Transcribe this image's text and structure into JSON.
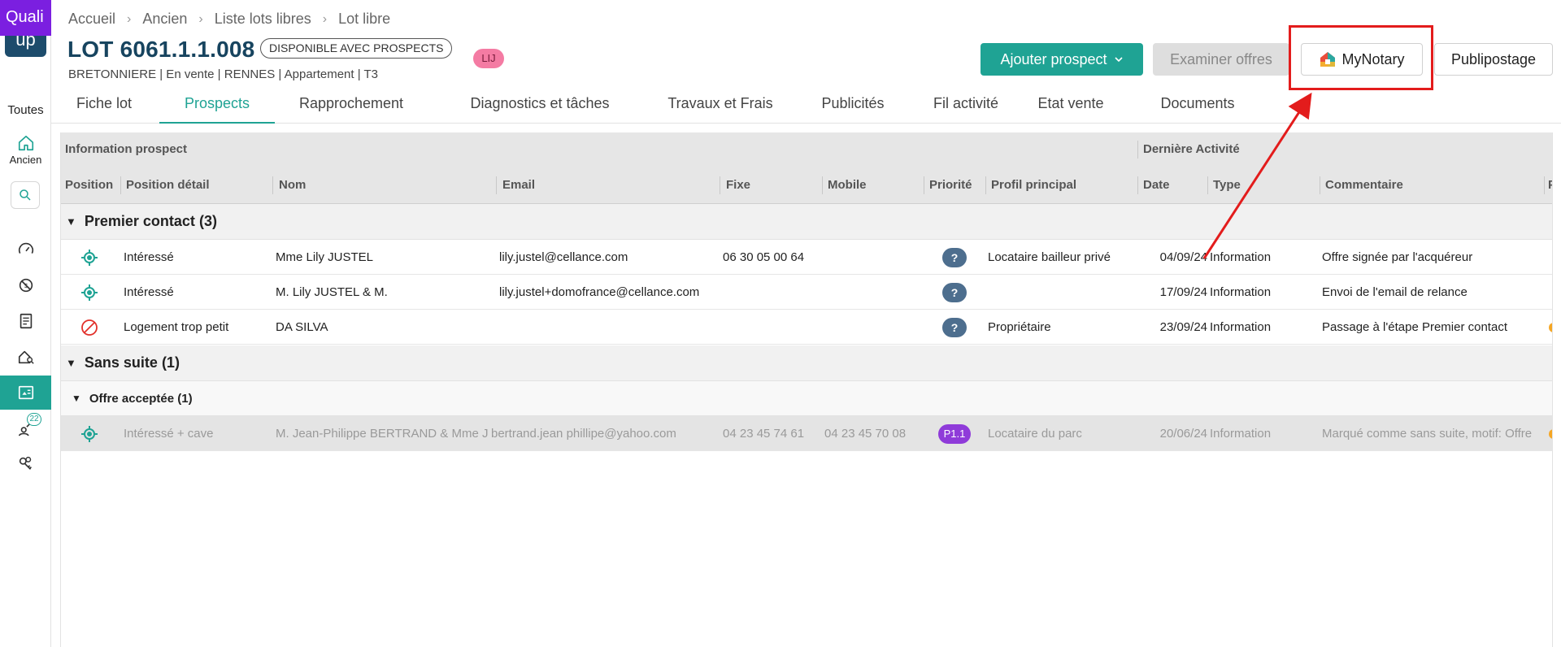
{
  "sidebar": {
    "logo_top": "Quali",
    "logo_bottom": "up",
    "scope_label": "Toutes",
    "active_module_label": "Ancien",
    "badge_count": "22",
    "icons": [
      "home-icon",
      "search-icon",
      "gauge-icon",
      "no-tag-icon",
      "checklist-icon",
      "house-search-icon",
      "building-card-icon",
      "hammer-person-icon",
      "keys-icon"
    ]
  },
  "breadcrumb": [
    "Accueil",
    "Ancien",
    "Liste lots libres",
    "Lot libre"
  ],
  "header": {
    "title": "LOT 6061.1.1.008",
    "status": "DISPONIBLE AVEC PROSPECTS",
    "badge": "LIJ",
    "subtitle": "BRETONNIERE | En vente | RENNES | Appartement | T3"
  },
  "actions": {
    "add_prospect": "Ajouter prospect",
    "review_offers": "Examiner offres",
    "mynotary": "MyNotary",
    "mailing": "Publipostage"
  },
  "tabs": [
    "Fiche lot",
    "Prospects",
    "Rapprochement",
    "Diagnostics et tâches",
    "Travaux et Frais",
    "Publicités",
    "Fil activité",
    "Etat vente",
    "Documents"
  ],
  "active_tab": "Prospects",
  "table": {
    "group_headers": [
      "Information prospect",
      "Dernière Activité"
    ],
    "columns": [
      "Position",
      "Position détail",
      "Nom",
      "Email",
      "Fixe",
      "Mobile",
      "Priorité",
      "Profil principal",
      "Date",
      "Type",
      "Commentaire",
      "P"
    ],
    "groups": [
      {
        "label": "Premier contact",
        "count": "(3)",
        "rows": [
          {
            "position_icon": "target-icon",
            "detail": "Intéressé",
            "nom": "Mme Lily JUSTEL",
            "email": "lily.justel@cellance.com",
            "fixe": "06 30 05 00 64",
            "mobile": "",
            "priorite": "?",
            "profil": "Locataire bailleur privé",
            "date": "04/09/24",
            "type": "Information",
            "commentaire": "Offre signée par l'acquéreur"
          },
          {
            "position_icon": "target-icon",
            "detail": "Intéressé",
            "nom": "M. Lily JUSTEL & M.",
            "email": "lily.justel+domofrance@cellance.com",
            "fixe": "",
            "mobile": "",
            "priorite": "?",
            "profil": "",
            "date": "17/09/24",
            "type": "Information",
            "commentaire": "Envoi de l'email de relance"
          },
          {
            "position_icon": "forbidden-icon",
            "detail": "Logement trop petit",
            "nom": "DA SILVA",
            "email": "",
            "fixe": "",
            "mobile": "",
            "priorite": "?",
            "profil": "Propriétaire",
            "date": "23/09/24",
            "type": "Information",
            "commentaire": "Passage à l'étape Premier contact"
          }
        ]
      },
      {
        "label": "Sans suite",
        "count": "(1)",
        "subgroups": [
          {
            "label": "Offre acceptée",
            "count": "(1)",
            "rows": [
              {
                "position_icon": "target-icon",
                "detail": "Intéressé + cave",
                "nom": "M. Jean-Philippe BERTRAND & Mme J",
                "email": "bertrand.jean phillipe@yahoo.com",
                "fixe": "04 23 45 74 61",
                "mobile": "04 23 45 70 08",
                "priorite": "P1.1",
                "profil": "Locataire du parc",
                "date": "20/06/24",
                "type": "Information",
                "commentaire": "Marqué comme sans suite, motif: Offre"
              }
            ]
          }
        ]
      }
    ]
  },
  "colors": {
    "brand_purple": "#7b1fe0",
    "accent_teal": "#1fa394",
    "title_navy": "#17445f",
    "annotation_red": "#e31c1c",
    "priority_purple": "#8f3bd9",
    "priority_question": "#4d6e8e"
  }
}
